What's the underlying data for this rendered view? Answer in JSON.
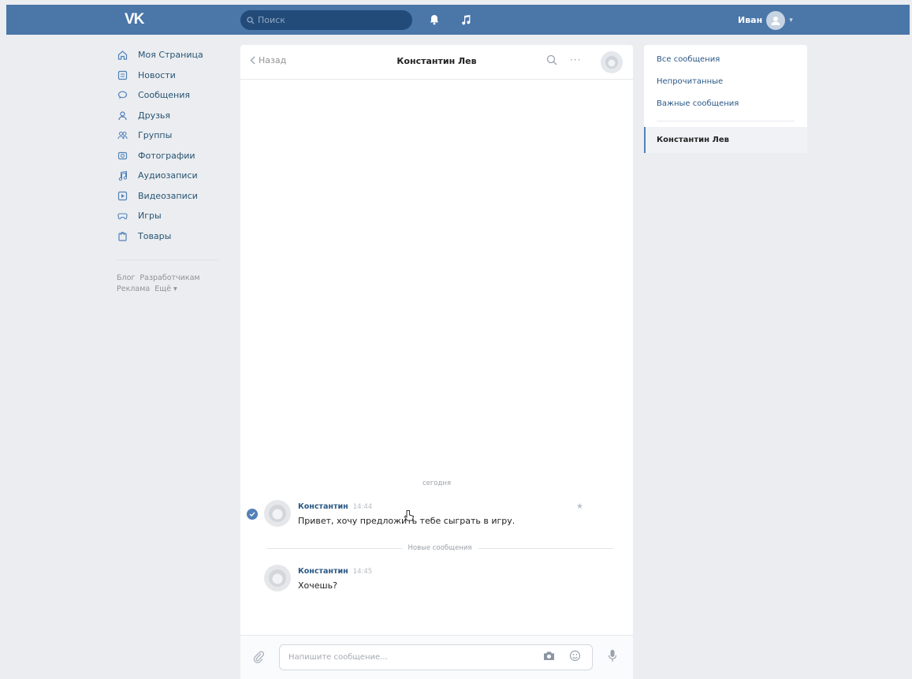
{
  "topbar": {
    "logo": "VK",
    "search_placeholder": "Поиск",
    "user_name": "Иван",
    "colors": {
      "bar": "#4a76a8",
      "search_bg": "#224b7a"
    },
    "icons": [
      "bell-icon",
      "music-note-icon",
      "user-avatar-icon",
      "chevron-down-icon"
    ]
  },
  "leftnav": {
    "items": [
      {
        "label": "Моя Страница",
        "icon": "home-icon"
      },
      {
        "label": "Новости",
        "icon": "news-icon"
      },
      {
        "label": "Сообщения",
        "icon": "messages-icon"
      },
      {
        "label": "Друзья",
        "icon": "friends-icon"
      },
      {
        "label": "Группы",
        "icon": "groups-icon"
      },
      {
        "label": "Фотографии",
        "icon": "photos-icon"
      },
      {
        "label": "Аудиозаписи",
        "icon": "audio-icon"
      },
      {
        "label": "Видеозаписи",
        "icon": "video-icon"
      },
      {
        "label": "Игры",
        "icon": "games-icon"
      },
      {
        "label": "Товары",
        "icon": "goods-icon"
      }
    ],
    "footer": [
      "Блог",
      "Разработчикам",
      "Реклама",
      "Ещё ▾"
    ]
  },
  "chat": {
    "back_label": "Назад",
    "title": "Константин Лев",
    "date_separator": "сегодня",
    "new_messages_label": "Новые сообщения",
    "messages": [
      {
        "author": "Константин",
        "time": "14:44",
        "text": "Привет, хочу предложить тебе сыграть в игру."
      },
      {
        "author": "Константин",
        "time": "14:45",
        "text": "Хочешь?"
      }
    ],
    "input_placeholder": "Напишите сообщение..."
  },
  "rightmenu": {
    "items": [
      "Все сообщения",
      "Непрочитанные",
      "Важные сообщения"
    ],
    "active_dialog": "Константин Лев",
    "accent": "#5181b8"
  }
}
